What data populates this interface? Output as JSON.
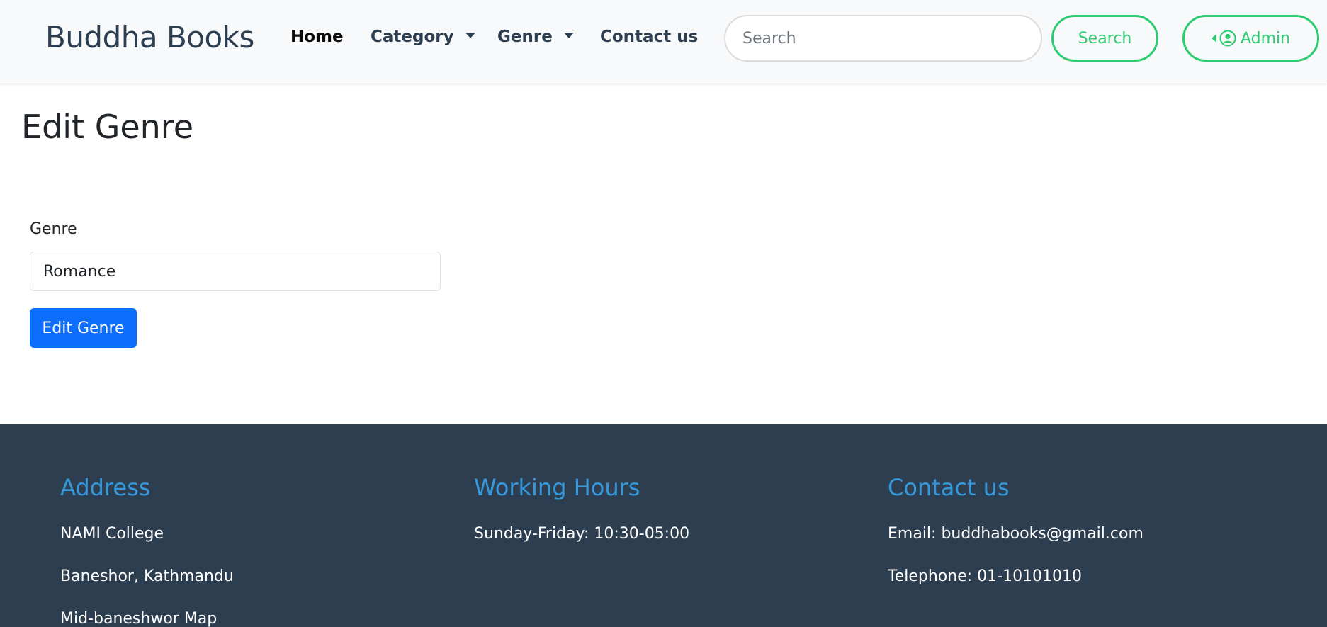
{
  "navbar": {
    "brand": "Buddha Books",
    "items": [
      {
        "label": "Home"
      },
      {
        "label": "Category"
      },
      {
        "label": "Genre"
      },
      {
        "label": "Contact us"
      }
    ],
    "search": {
      "placeholder": "Search",
      "value": ""
    },
    "search_button": "Search",
    "admin_button": "Admin"
  },
  "main": {
    "title": "Edit Genre",
    "form": {
      "label": "Genre",
      "value": "Romance",
      "submit_label": "Edit Genre"
    }
  },
  "footer": {
    "address": {
      "heading": "Address",
      "lines": [
        "NAMI College",
        "Baneshor, Kathmandu",
        "Mid-baneshwor Map"
      ]
    },
    "hours": {
      "heading": "Working Hours",
      "lines": [
        "Sunday-Friday: 10:30-05:00"
      ]
    },
    "contact": {
      "heading": "Contact us",
      "lines": [
        "Email: buddhabooks@gmail.com",
        "Telephone: 01-10101010"
      ]
    }
  },
  "colors": {
    "brand_text": "#2c3e50",
    "accent_green": "#2ecc71",
    "primary_blue": "#0d6efd",
    "footer_bg": "#2d3e50",
    "footer_heading": "#3498db"
  },
  "icons": {
    "admin": "user-circle-icon",
    "dropdown": "caret-down-icon"
  }
}
